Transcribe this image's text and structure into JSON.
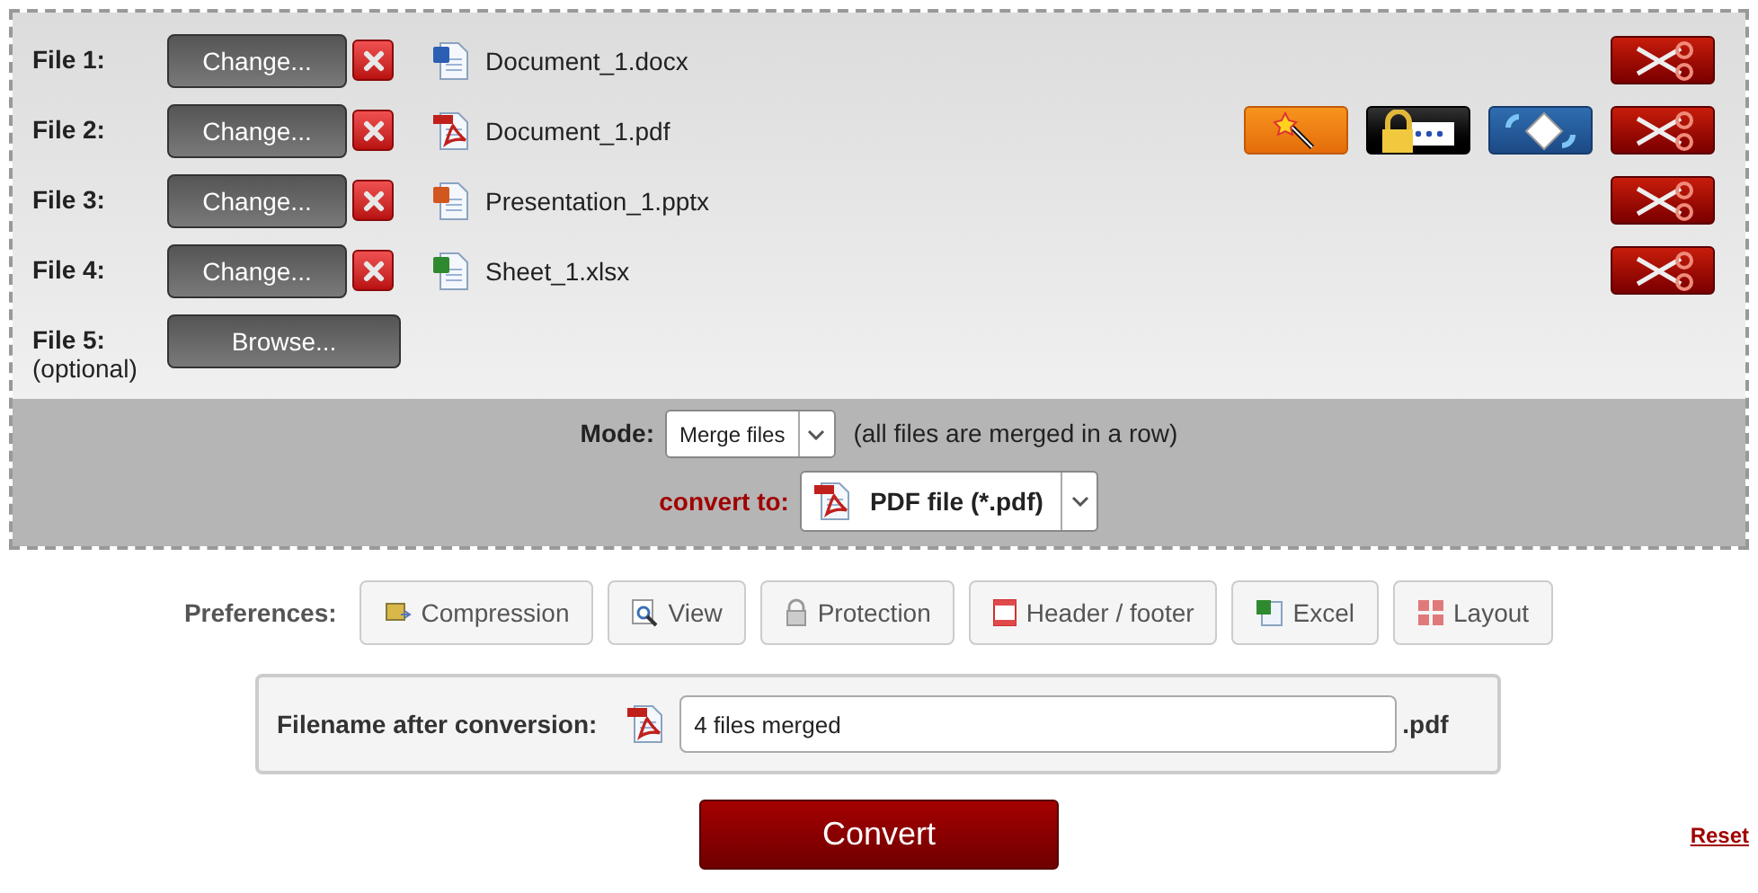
{
  "files": [
    {
      "label": "File 1:",
      "button": "Change...",
      "kind": "word",
      "filename": "Document_1.docx"
    },
    {
      "label": "File 2:",
      "button": "Change...",
      "kind": "pdf",
      "filename": "Document_1.pdf",
      "tools": [
        {
          "kind": "wand"
        },
        {
          "kind": "lock"
        },
        {
          "kind": "rotate"
        }
      ]
    },
    {
      "label": "File 3:",
      "button": "Change...",
      "kind": "powerpoint",
      "filename": "Presentation_1.pptx"
    },
    {
      "label": "File 4:",
      "button": "Change...",
      "kind": "excel",
      "filename": "Sheet_1.xlsx"
    },
    {
      "label": "File 5:",
      "sublabel": "(optional)",
      "button": "Browse...",
      "kind": "empty"
    }
  ],
  "mode": {
    "label": "Mode:",
    "value": "Merge files",
    "note": "(all files are merged in a row)"
  },
  "convert_to": {
    "label": "convert to:",
    "value": "PDF file (*.pdf)"
  },
  "preferences": {
    "label": "Preferences:",
    "buttons": [
      {
        "label": "Compression"
      },
      {
        "label": "View"
      },
      {
        "label": "Protection"
      },
      {
        "label": "Header / footer"
      },
      {
        "label": "Excel"
      },
      {
        "label": "Layout"
      }
    ]
  },
  "filename": {
    "label": "Filename after conversion:",
    "value": "4 files merged",
    "extension": ".pdf"
  },
  "convert_button": "Convert",
  "reset_link": "Reset"
}
